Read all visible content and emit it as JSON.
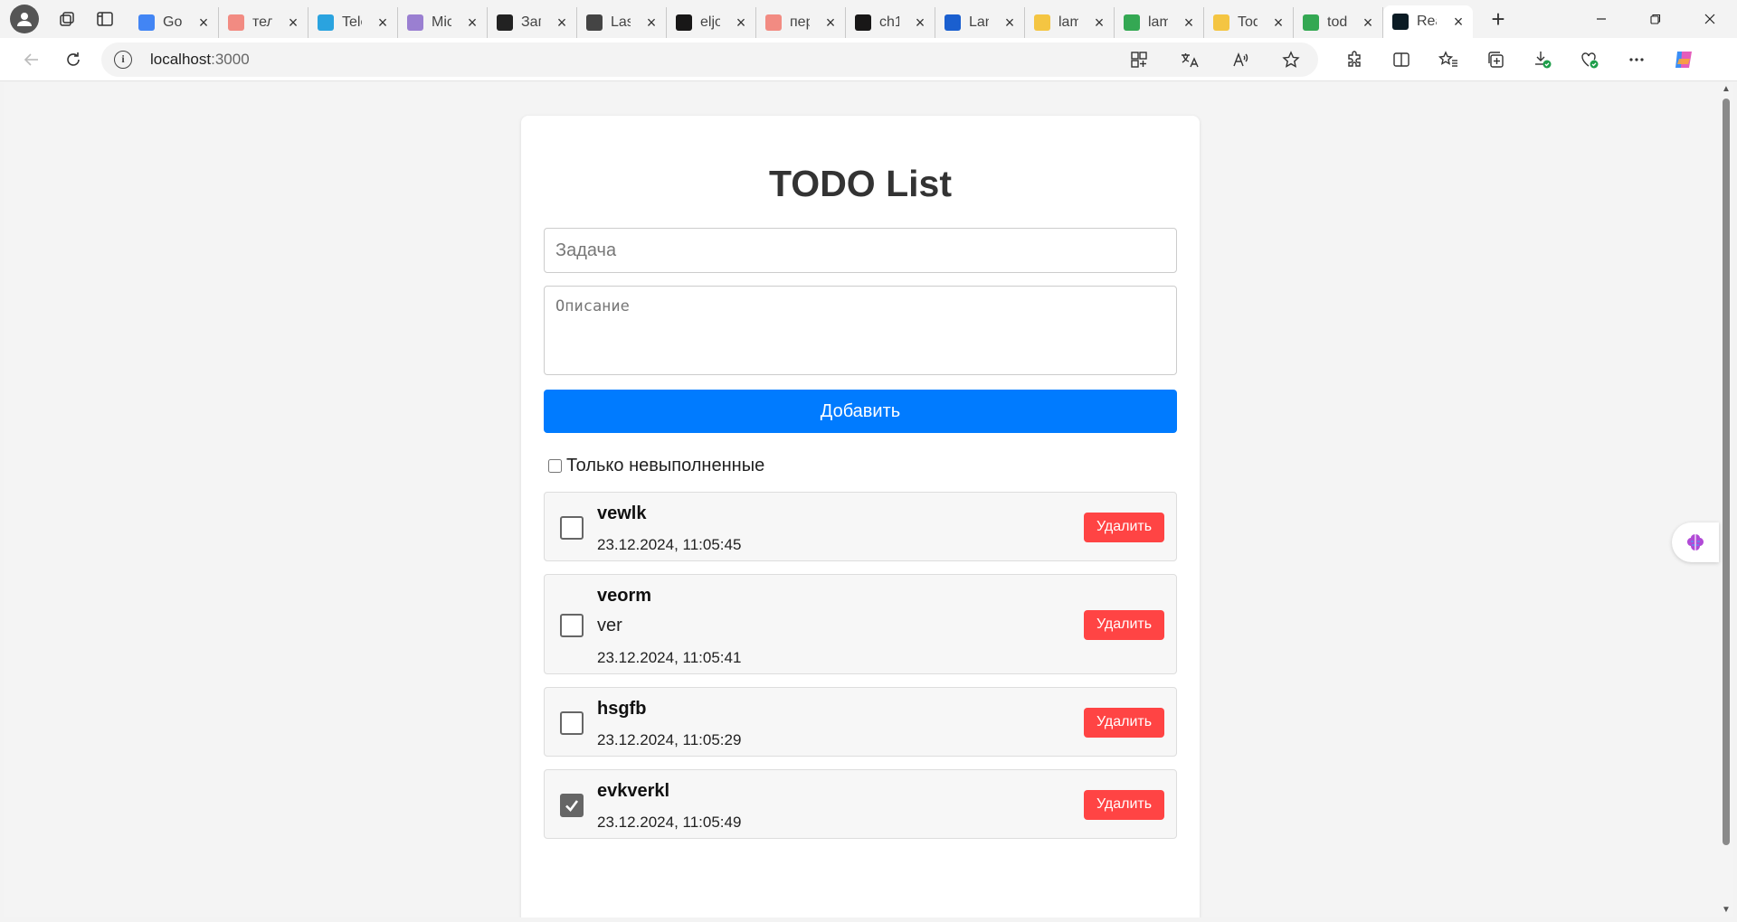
{
  "browser": {
    "tabs": [
      {
        "label": "Goo",
        "favicon": "google-icon",
        "color": "#4285f4"
      },
      {
        "label": "тел",
        "favicon": "yandex-icon",
        "color": "#f28b82"
      },
      {
        "label": "Tele",
        "favicon": "telegram-icon",
        "color": "#2aa3df"
      },
      {
        "label": "Mic",
        "favicon": "copilot-icon",
        "color": "#9a7fd1"
      },
      {
        "label": "Зап",
        "favicon": "bot-icon",
        "color": "#222222"
      },
      {
        "label": "Las",
        "favicon": "document-icon",
        "color": "#444444"
      },
      {
        "label": "eljo",
        "favicon": "github-icon",
        "color": "#181717"
      },
      {
        "label": "пер",
        "favicon": "yandex-icon",
        "color": "#f28b82"
      },
      {
        "label": "ch1",
        "favicon": "github-icon",
        "color": "#181717"
      },
      {
        "label": "Lan",
        "favicon": "contact-icon",
        "color": "#1a5fcf"
      },
      {
        "label": "lam",
        "favicon": "folder-icon",
        "color": "#f4c542"
      },
      {
        "label": "lam",
        "favicon": "drive-icon",
        "color": "#34a853"
      },
      {
        "label": "Tod",
        "favicon": "folder-icon",
        "color": "#f4c542"
      },
      {
        "label": "tod",
        "favicon": "drive-icon",
        "color": "#34a853"
      },
      {
        "label": "Rea",
        "favicon": "react-icon",
        "color": "#0b1b24"
      }
    ],
    "active_tab_index": 14,
    "new_tab_label": "+",
    "url_host": "localhost",
    "url_port": ":3000"
  },
  "app": {
    "title": "TODO List",
    "task_placeholder": "Задача",
    "description_placeholder": "Описание",
    "add_button": "Добавить",
    "filter_label": "Только невыполненные",
    "filter_checked": false,
    "delete_label": "Удалить",
    "todos": [
      {
        "title": "vewlk",
        "description": "",
        "date": "23.12.2024, 11:05:45",
        "done": false
      },
      {
        "title": "veorm",
        "description": "ver",
        "date": "23.12.2024, 11:05:41",
        "done": false
      },
      {
        "title": "hsgfb",
        "description": "",
        "date": "23.12.2024, 11:05:29",
        "done": false
      },
      {
        "title": "evkverkl",
        "description": "",
        "date": "23.12.2024, 11:05:49",
        "done": true
      }
    ]
  },
  "colors": {
    "primary": "#007bff",
    "danger": "#ff4444"
  }
}
